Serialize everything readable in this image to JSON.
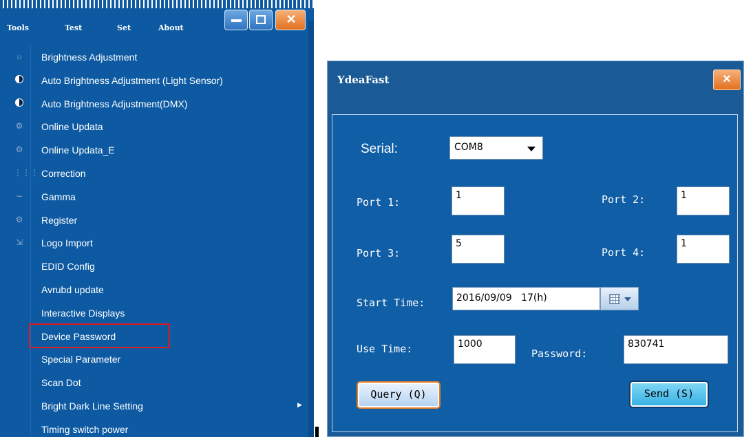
{
  "menu_window": {
    "menubar": [
      "Tools",
      "Test",
      "Set",
      "About"
    ],
    "caption_buttons": {
      "minimize": "minimize-icon",
      "maximize": "maximize-icon",
      "close": "✕"
    },
    "items": [
      {
        "label": "Brightness Adjustment",
        "icon": "sun-icon",
        "glyph": "☼"
      },
      {
        "label": "Auto Brightness Adjustment (Light Sensor)",
        "icon": "half-circle-icon",
        "glyph": ""
      },
      {
        "label": "Auto Brightness Adjustment(DMX)",
        "icon": "half-circle-icon",
        "glyph": ""
      },
      {
        "label": "Online Updata",
        "icon": "gear-icon",
        "glyph": "⚙"
      },
      {
        "label": "Online Updata_E",
        "icon": "gear-icon",
        "glyph": "⚙"
      },
      {
        "label": "Correction",
        "icon": "grid-icon",
        "glyph": "⋮⋮⋮"
      },
      {
        "label": "Gamma",
        "icon": "curve-icon",
        "glyph": "∼"
      },
      {
        "label": "Register",
        "icon": "gear-icon",
        "glyph": "⚙"
      },
      {
        "label": "Logo Import",
        "icon": "import-icon",
        "glyph": "⇲"
      },
      {
        "label": "EDID Config",
        "icon": "",
        "glyph": ""
      },
      {
        "label": "Avrubd update",
        "icon": "",
        "glyph": ""
      },
      {
        "label": "Interactive Displays",
        "icon": "",
        "glyph": ""
      },
      {
        "label": "Device Password",
        "icon": "",
        "glyph": ""
      },
      {
        "label": "Special Parameter",
        "icon": "",
        "glyph": ""
      },
      {
        "label": "Scan Dot",
        "icon": "",
        "glyph": ""
      },
      {
        "label": "Bright Dark Line Setting",
        "icon": "",
        "glyph": "",
        "submenu": "▶"
      },
      {
        "label": "Timing switch power",
        "icon": "",
        "glyph": ""
      }
    ]
  },
  "dialog": {
    "title": "YdeaFast",
    "close_glyph": "✕",
    "serial": {
      "label": "Serial:",
      "value": "COM8"
    },
    "port1": {
      "label": "Port 1:",
      "value": "1"
    },
    "port2": {
      "label": "Port 2:",
      "value": "1"
    },
    "port3": {
      "label": "Port 3:",
      "value": "5"
    },
    "port4": {
      "label": "Port 4:",
      "value": "1"
    },
    "start_time": {
      "label": "Start Time:",
      "value": "2016/09/09   17(h)"
    },
    "use_time": {
      "label": "Use Time:",
      "value": "1000"
    },
    "password": {
      "label": "Password:",
      "value": "830741"
    },
    "query_button": "Query (Q)",
    "send_button": "Send (S)"
  },
  "colors": {
    "window_blue": "#0d5aa3",
    "highlight_red": "#e0191f",
    "close_orange": "#e2701f"
  }
}
